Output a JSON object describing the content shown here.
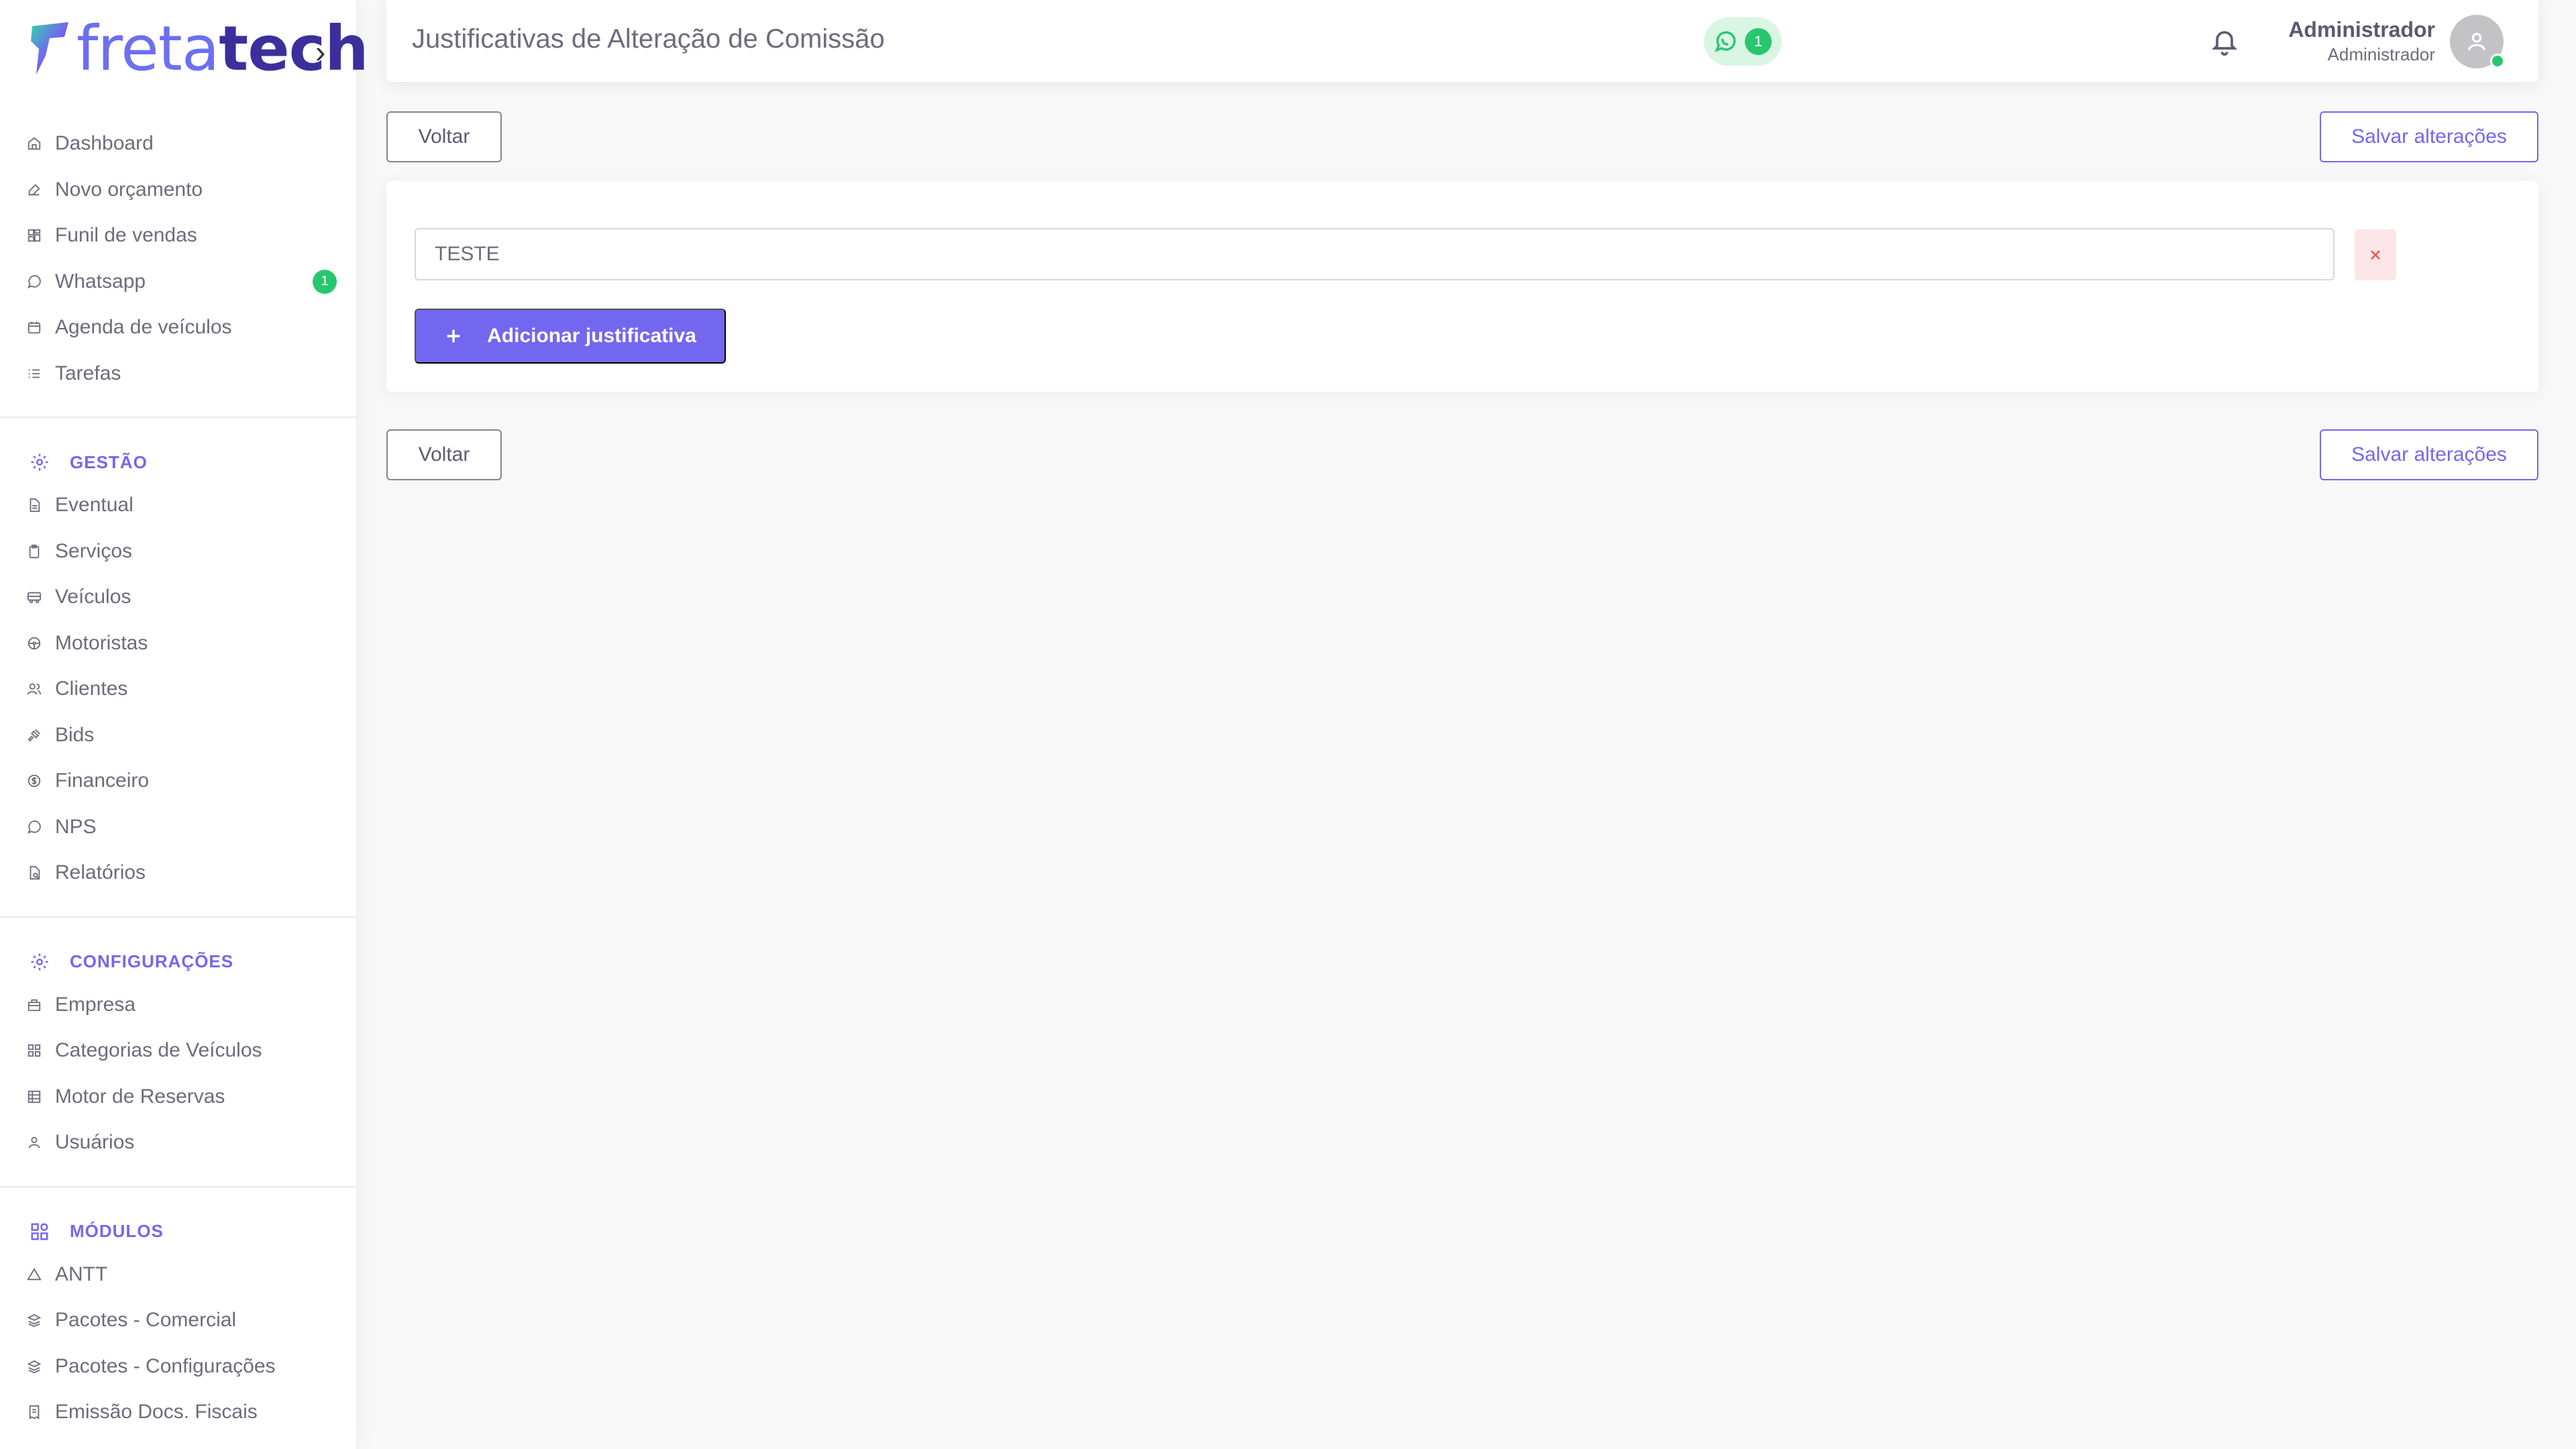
{
  "brand": {
    "light": "freta",
    "bold": "tech",
    "toggle": "›"
  },
  "sidebar": {
    "main_items": [
      {
        "label": "Dashboard",
        "icon": "home-icon"
      },
      {
        "label": "Novo orçamento",
        "icon": "edit-icon"
      },
      {
        "label": "Funil de vendas",
        "icon": "funnel-icon"
      },
      {
        "label": "Whatsapp",
        "icon": "whatsapp-icon",
        "badge": "1"
      },
      {
        "label": "Agenda de veículos",
        "icon": "calendar-icon"
      },
      {
        "label": "Tarefas",
        "icon": "list-icon"
      }
    ],
    "gestao": {
      "title": "GESTÃO",
      "items": [
        {
          "label": "Eventual",
          "icon": "file-icon"
        },
        {
          "label": "Serviços",
          "icon": "clipboard-icon"
        },
        {
          "label": "Veículos",
          "icon": "bus-icon"
        },
        {
          "label": "Motoristas",
          "icon": "steering-wheel-icon"
        },
        {
          "label": "Clientes",
          "icon": "users-icon"
        },
        {
          "label": "Bids",
          "icon": "gavel-icon"
        },
        {
          "label": "Financeiro",
          "icon": "dollar-circle-icon"
        },
        {
          "label": "NPS",
          "icon": "message-circle-icon"
        },
        {
          "label": "Relatórios",
          "icon": "report-icon"
        }
      ]
    },
    "configuracoes": {
      "title": "CONFIGURAÇÕES",
      "items": [
        {
          "label": "Empresa",
          "icon": "building-icon"
        },
        {
          "label": "Categorias de Veículos",
          "icon": "grid-icon"
        },
        {
          "label": "Motor de Reservas",
          "icon": "table-icon"
        },
        {
          "label": "Usuários",
          "icon": "user-icon"
        }
      ]
    },
    "modulos": {
      "title": "MÓDULOS",
      "items": [
        {
          "label": "ANTT",
          "icon": "triangle-icon"
        },
        {
          "label": "Pacotes - Comercial",
          "icon": "package-icon"
        },
        {
          "label": "Pacotes - Configurações",
          "icon": "package-settings-icon"
        },
        {
          "label": "Emissão Docs. Fiscais",
          "icon": "receipt-icon"
        }
      ]
    }
  },
  "header": {
    "title": "Justificativas de Alteração de Comissão",
    "whatsapp_count": "1",
    "user_name": "Administrador",
    "user_role": "Administrador"
  },
  "actions": {
    "back_label": "Voltar",
    "save_label": "Salvar alterações"
  },
  "justifications": {
    "items": [
      {
        "value": "TESTE"
      }
    ],
    "add_label": "Adicionar justificativa"
  },
  "colors": {
    "accent": "#7367f0",
    "success": "#28c76f",
    "danger": "#ea5455"
  }
}
